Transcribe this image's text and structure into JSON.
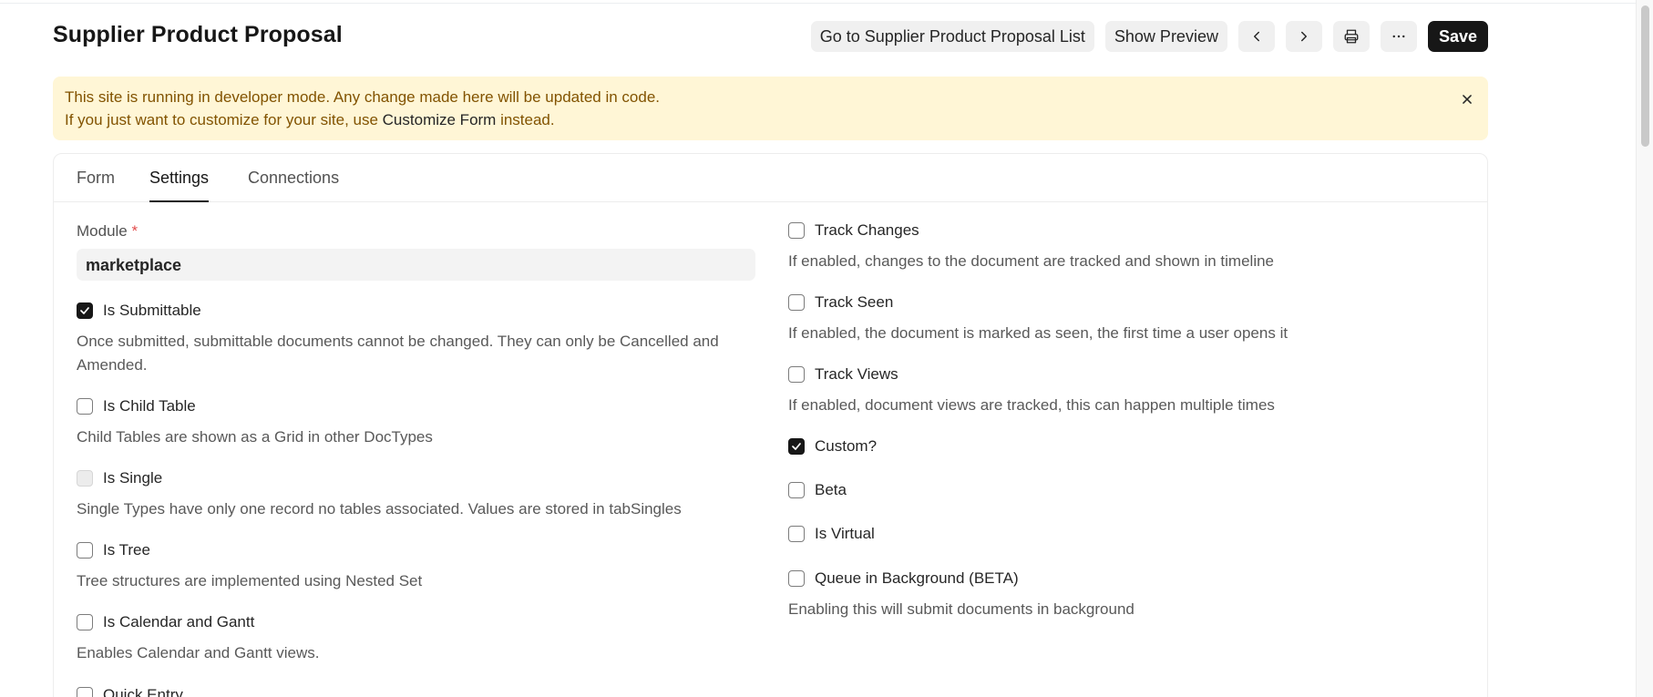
{
  "header": {
    "title": "Supplier Product Proposal",
    "goto_list_label": "Go to Supplier Product Proposal List",
    "show_preview_label": "Show Preview",
    "prev_icon": "chevron-left-icon",
    "next_icon": "chevron-right-icon",
    "print_icon": "printer-icon",
    "more_icon": "more-horizontal-icon",
    "save_label": "Save"
  },
  "alert": {
    "line1": "This site is running in developer mode. Any change made here will be updated in code.",
    "line2_prefix": "If you just want to customize for your site, use ",
    "line2_link": "Customize Form",
    "line2_suffix": " instead."
  },
  "tabs": [
    {
      "label": "Form",
      "active": false
    },
    {
      "label": "Settings",
      "active": true
    },
    {
      "label": "Connections",
      "active": false
    }
  ],
  "left": {
    "module": {
      "label": "Module",
      "required_mark": "*",
      "value": "marketplace"
    },
    "checkboxes": [
      {
        "label": "Is Submittable",
        "checked": true,
        "description_1": "Once submitted, submittable documents cannot be changed. They can only be Cancelled and",
        "description_2": "Amended."
      },
      {
        "label": "Is Child Table",
        "checked": false,
        "description_1": "Child Tables are shown as a Grid in other DocTypes"
      },
      {
        "label": "Is Single",
        "checked": false,
        "disabled": true,
        "description_1": "Single Types have only one record no tables associated. Values are stored in tabSingles"
      },
      {
        "label": "Is Tree",
        "checked": false,
        "description_1": "Tree structures are implemented using Nested Set"
      },
      {
        "label": "Is Calendar and Gantt",
        "checked": false,
        "description_1": "Enables Calendar and Gantt views."
      },
      {
        "label": "Quick Entry",
        "checked": false
      }
    ]
  },
  "right": {
    "checkboxes": [
      {
        "label": "Track Changes",
        "checked": false,
        "description_1": "If enabled, changes to the document are tracked and shown in timeline"
      },
      {
        "label": "Track Seen",
        "checked": false,
        "description_1": "If enabled, the document is marked as seen, the first time a user opens it"
      },
      {
        "label": "Track Views",
        "checked": false,
        "description_1": "If enabled, document views are tracked, this can happen multiple times"
      },
      {
        "label": "Custom?",
        "checked": true
      },
      {
        "label": "Beta",
        "checked": false
      },
      {
        "label": "Is Virtual",
        "checked": false
      },
      {
        "label": "Queue in Background (BETA)",
        "checked": false,
        "description_1": "Enabling this will submit documents in background"
      }
    ]
  },
  "colors": {
    "alert_bg": "#fff6d6",
    "alert_text": "#825300",
    "primary": "#171717"
  }
}
